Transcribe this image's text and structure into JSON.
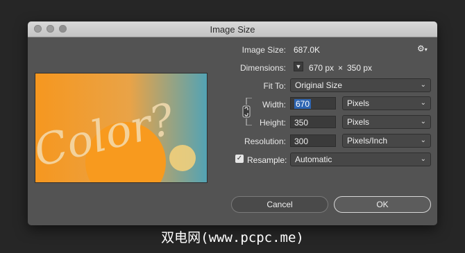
{
  "window": {
    "title": "Image Size"
  },
  "info": {
    "image_size_label": "Image Size:",
    "image_size_value": "687.0K",
    "dimensions_label": "Dimensions:",
    "dim_width": "670 px",
    "dim_times": "×",
    "dim_height": "350 px"
  },
  "fit_to": {
    "label": "Fit To:",
    "value": "Original Size"
  },
  "width": {
    "label": "Width:",
    "value": "670",
    "unit": "Pixels"
  },
  "height": {
    "label": "Height:",
    "value": "350",
    "unit": "Pixels"
  },
  "resolution": {
    "label": "Resolution:",
    "value": "300",
    "unit": "Pixels/Inch"
  },
  "resample": {
    "label": "Resample:",
    "value": "Automatic",
    "checked": true
  },
  "buttons": {
    "cancel": "Cancel",
    "ok": "OK"
  },
  "preview": {
    "text": "Color?"
  },
  "watermark": "双电网(www.pcpc.me)",
  "colors": {
    "dialog_bg": "#535353",
    "preview_orange": "#f49524",
    "preview_teal": "#5aa3ae",
    "selection": "#2f66b3"
  }
}
